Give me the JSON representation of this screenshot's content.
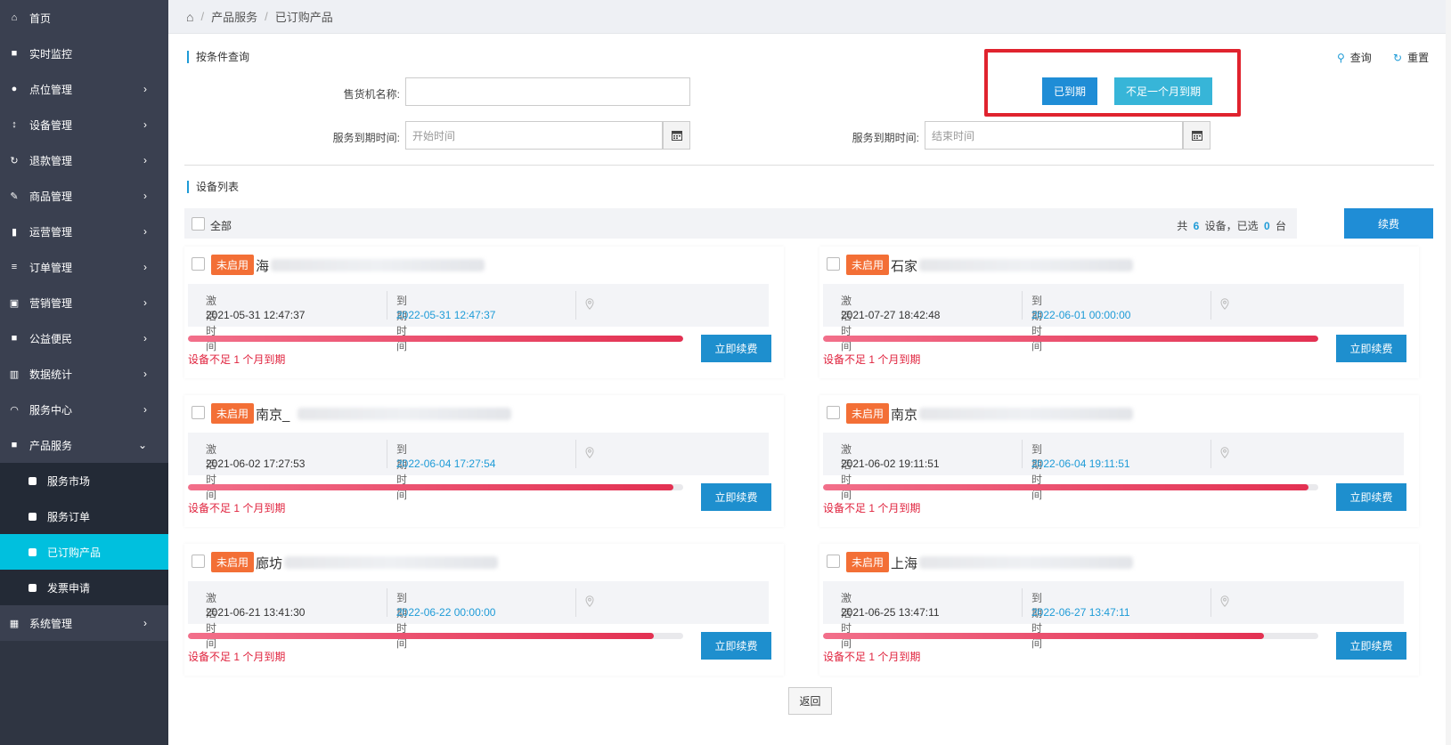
{
  "sidebar": {
    "items": [
      {
        "label": "首页",
        "icon": "home-icon",
        "glyph": "⌂",
        "has_children": false
      },
      {
        "label": "实时监控",
        "icon": "video-camera-icon",
        "glyph": "■",
        "has_children": false
      },
      {
        "label": "点位管理",
        "icon": "map-pin-icon",
        "glyph": "●",
        "has_children": true
      },
      {
        "label": "设备管理",
        "icon": "sort-icon",
        "glyph": "↕",
        "has_children": true
      },
      {
        "label": "退款管理",
        "icon": "refresh-icon",
        "glyph": "↻",
        "has_children": true
      },
      {
        "label": "商品管理",
        "icon": "edit-icon",
        "glyph": "✎",
        "has_children": true
      },
      {
        "label": "运营管理",
        "icon": "bookmark-icon",
        "glyph": "▮",
        "has_children": true
      },
      {
        "label": "订单管理",
        "icon": "list-icon",
        "glyph": "≡",
        "has_children": true
      },
      {
        "label": "营销管理",
        "icon": "shop-icon",
        "glyph": "▣",
        "has_children": true
      },
      {
        "label": "公益便民",
        "icon": "square-icon",
        "glyph": "■",
        "has_children": true
      },
      {
        "label": "数据统计",
        "icon": "bar-chart-icon",
        "glyph": "▥",
        "has_children": true
      },
      {
        "label": "服务中心",
        "icon": "headset-icon",
        "glyph": "◠",
        "has_children": true
      },
      {
        "label": "产品服务",
        "icon": "square-icon",
        "glyph": "■",
        "has_children": true,
        "expanded": true
      }
    ],
    "sub_items": [
      {
        "label": "服务市场",
        "active": false
      },
      {
        "label": "服务订单",
        "active": false
      },
      {
        "label": "已订购产品",
        "active": true
      },
      {
        "label": "发票申请",
        "active": false
      }
    ],
    "bottom_item": {
      "label": "系统管理",
      "icon": "table-icon",
      "glyph": "▦"
    }
  },
  "breadcrumb": {
    "home_icon": "home-icon",
    "items": [
      "产品服务",
      "已订购产品"
    ],
    "separator": "/"
  },
  "search": {
    "section_title": "按条件查询",
    "machine_name_label": "售货机名称:",
    "machine_name_value": "",
    "expire_start_label": "服务到期时间:",
    "expire_start_placeholder": "开始时间",
    "expire_end_label": "服务到期时间:",
    "expire_end_placeholder": "结束时间",
    "expired_button": "已到期",
    "less_than_month_button": "不足一个月到期",
    "query_label": "查询",
    "reset_label": "重置"
  },
  "device_list": {
    "section_title": "设备列表",
    "select_all_label": "全部",
    "summary_prefix": "共",
    "total": "6",
    "summary_mid": "设备，已选",
    "selected": "0",
    "summary_suffix": "台",
    "renew_all_button": "续费",
    "activation_label": "激活时间",
    "expire_label": "到期时间",
    "devices": [
      {
        "badge": "未启用",
        "name": "海",
        "activated": "2021-05-31 12:47:37",
        "expires": "2022-05-31 12:47:37",
        "progress": 1.0,
        "warning": "设备不足 1 个月到期",
        "renew_button": "立即续费"
      },
      {
        "badge": "未启用",
        "name": "石家",
        "activated": "2021-07-27 18:42:48",
        "expires": "2022-06-01 00:00:00",
        "progress": 1.0,
        "warning": "设备不足 1 个月到期",
        "renew_button": "立即续费"
      },
      {
        "badge": "未启用",
        "name": "南京_",
        "activated": "2021-06-02 17:27:53",
        "expires": "2022-06-04 17:27:54",
        "progress": 0.98,
        "warning": "设备不足 1 个月到期",
        "renew_button": "立即续费"
      },
      {
        "badge": "未启用",
        "name": "南京",
        "activated": "2021-06-02 19:11:51",
        "expires": "2022-06-04 19:11:51",
        "progress": 0.98,
        "warning": "设备不足 1 个月到期",
        "renew_button": "立即续费"
      },
      {
        "badge": "未启用",
        "name": "廊坊",
        "activated": "2021-06-21 13:41:30",
        "expires": "2022-06-22 00:00:00",
        "progress": 0.94,
        "warning": "设备不足 1 个月到期",
        "renew_button": "立即续费"
      },
      {
        "badge": "未启用",
        "name": "上海",
        "activated": "2021-06-25 13:47:11",
        "expires": "2022-06-27 13:47:11",
        "progress": 0.89,
        "warning": "设备不足 1 个月到期",
        "renew_button": "立即续费"
      }
    ]
  },
  "back_button": "返回",
  "colors": {
    "sidebar_bg": "#2f3542",
    "active_sub": "#00c0de",
    "primary": "#1f8dd6",
    "badge": "#f36f36",
    "warning": "#e0233e",
    "highlight_box": "#e0232e"
  }
}
